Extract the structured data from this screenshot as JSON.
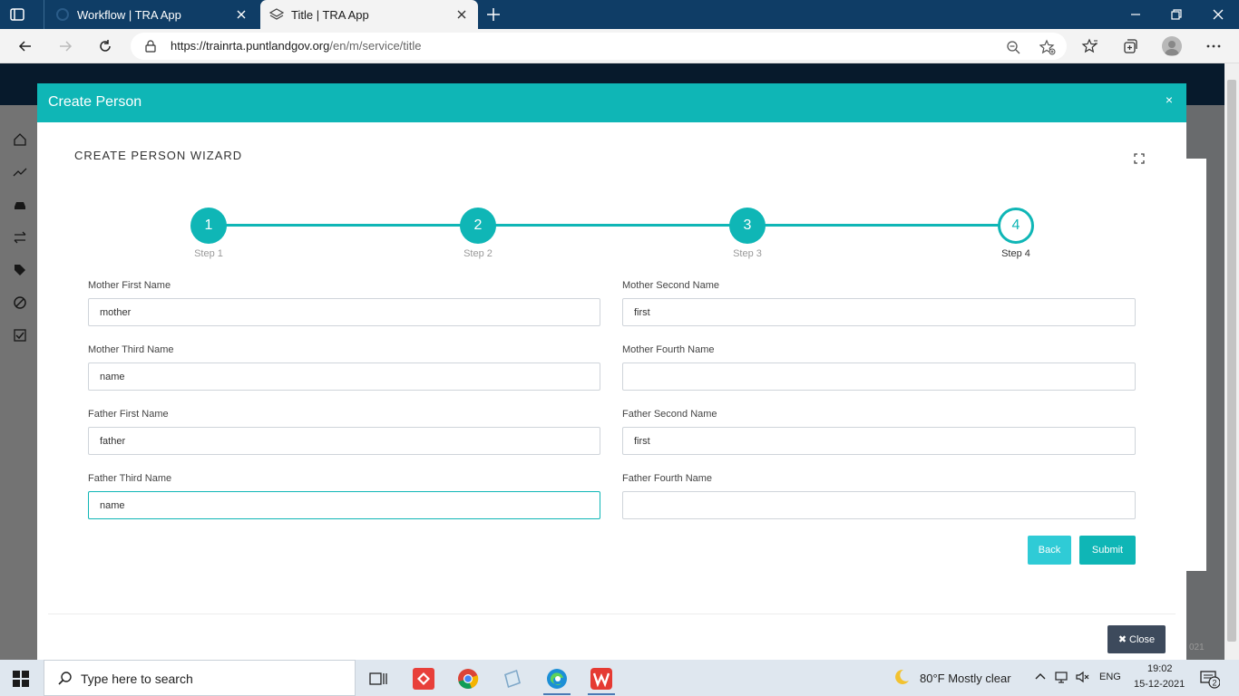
{
  "browser": {
    "tabs": [
      {
        "title": "Workflow | TRA App",
        "active": false
      },
      {
        "title": "Title | TRA App",
        "active": true
      }
    ],
    "url_host": "https://trainrta.puntlandgov.org",
    "url_path": "/en/m/service/title"
  },
  "modal": {
    "title": "Create Person",
    "wizard_title": "CREATE PERSON WIZARD",
    "steps": [
      {
        "number": "1",
        "label": "Step 1",
        "state": "complete"
      },
      {
        "number": "2",
        "label": "Step 2",
        "state": "complete"
      },
      {
        "number": "3",
        "label": "Step 3",
        "state": "complete"
      },
      {
        "number": "4",
        "label": "Step 4",
        "state": "current"
      }
    ],
    "fields": {
      "mother_first": {
        "label": "Mother First Name",
        "value": "mother"
      },
      "mother_second": {
        "label": "Mother Second Name",
        "value": "first"
      },
      "mother_third": {
        "label": "Mother Third Name",
        "value": "name"
      },
      "mother_fourth": {
        "label": "Mother Fourth Name",
        "value": ""
      },
      "father_first": {
        "label": "Father First Name",
        "value": "father"
      },
      "father_second": {
        "label": "Father Second Name",
        "value": "first"
      },
      "father_third": {
        "label": "Father Third Name",
        "value": "name"
      },
      "father_fourth": {
        "label": "Father Fourth Name",
        "value": ""
      }
    },
    "back_label": "Back",
    "submit_label": "Submit",
    "close_label": "Close"
  },
  "page_footer_fragment": "021",
  "taskbar": {
    "search_placeholder": "Type here to search",
    "weather": "80°F  Mostly clear",
    "language": "ENG",
    "time": "19:02",
    "date": "15-12-2021",
    "notification_count": "2"
  },
  "colors": {
    "accent": "#0fb6b6",
    "back_button": "#2fcbd6",
    "close_button": "#3d4a5c",
    "browser_tabbar": "#0f3d66"
  }
}
